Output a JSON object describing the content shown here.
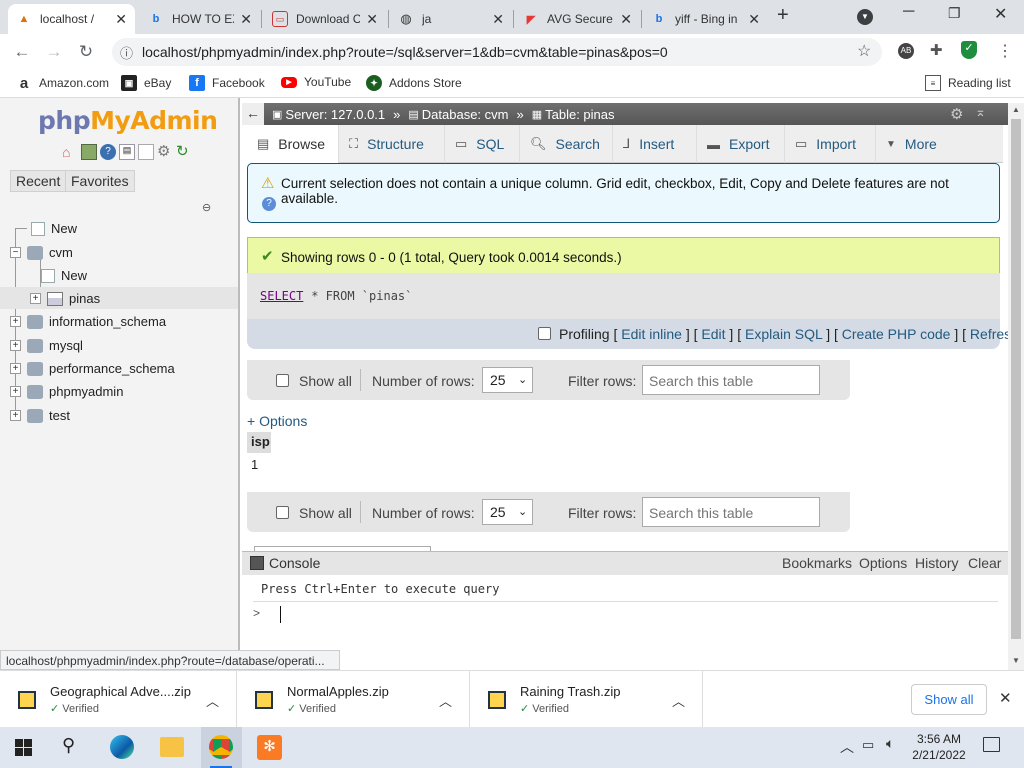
{
  "browser": {
    "tabs": [
      {
        "title": "localhost / ",
        "active": true
      },
      {
        "title": "HOW TO EX",
        "active": false
      },
      {
        "title": "Download C",
        "active": false
      },
      {
        "title": "ja",
        "active": false
      },
      {
        "title": "AVG Secure",
        "active": false
      },
      {
        "title": "yiff - Bing in",
        "active": false
      }
    ],
    "new_tab": "+",
    "url": "localhost/phpmyadmin/index.php?route=/sql&server=1&db=cvm&table=pinas&pos=0",
    "bookmarks": [
      "Amazon.com",
      "eBay",
      "Facebook",
      "YouTube",
      "Addons Store"
    ],
    "reading_list": "Reading list"
  },
  "pma": {
    "logo_php": "php",
    "logo_myadmin": "MyAdmin",
    "recent": "Recent",
    "favorites": "Favorites",
    "tree": {
      "new": "New",
      "cvm": "cvm",
      "cvm_new": "New",
      "pinas": "pinas",
      "information_schema": "information_schema",
      "mysql": "mysql",
      "performance_schema": "performance_schema",
      "phpmyadmin": "phpmyadmin",
      "test": "test"
    },
    "breadcrumb": {
      "server": "Server: 127.0.0.1",
      "database": "Database: cvm",
      "table": "Table: pinas",
      "sep": "»"
    },
    "menu": [
      "Browse",
      "Structure",
      "SQL",
      "Search",
      "Insert",
      "Export",
      "Import",
      "More"
    ],
    "notice": "Current selection does not contain a unique column. Grid edit, checkbox, Edit, Copy and Delete features are not available.",
    "success": "Showing rows 0 - 0 (1 total, Query took 0.0014 seconds.)",
    "sql": {
      "select": "SELECT",
      "rest": " * FROM `pinas`"
    },
    "query_links": {
      "profiling": "Profiling",
      "edit_inline": "Edit inline",
      "edit": "Edit",
      "explain": "Explain SQL",
      "php": "Create PHP code",
      "refresh": "Refresh"
    },
    "navrow": {
      "show_all": "Show all",
      "num_rows_label": "Number of rows:",
      "num_rows_value": "25",
      "filter_label": "Filter rows:",
      "filter_placeholder": "Search this table"
    },
    "options": "+ Options",
    "result": {
      "column": "isp",
      "value": "1"
    },
    "console": {
      "title": "Console",
      "bookmarks": "Bookmarks",
      "options": "Options",
      "history": "History",
      "clear": "Clear",
      "hint": "Press Ctrl+Enter to execute query",
      "prompt": ">"
    }
  },
  "status_url": "localhost/phpmyadmin/index.php?route=/database/operati...",
  "downloads": {
    "items": [
      {
        "name": "Geographical Adve....zip",
        "status": "Verified"
      },
      {
        "name": "NormalApples.zip",
        "status": "Verified"
      },
      {
        "name": "Raining Trash.zip",
        "status": "Verified"
      }
    ],
    "show_all": "Show all"
  },
  "taskbar": {
    "time": "3:56 AM",
    "date": "2/21/2022"
  },
  "colors": {
    "link": "#235a81",
    "notice_bg": "#ebf8fd",
    "success_bg": "#ebf8a4",
    "server_bar": "#666666"
  }
}
